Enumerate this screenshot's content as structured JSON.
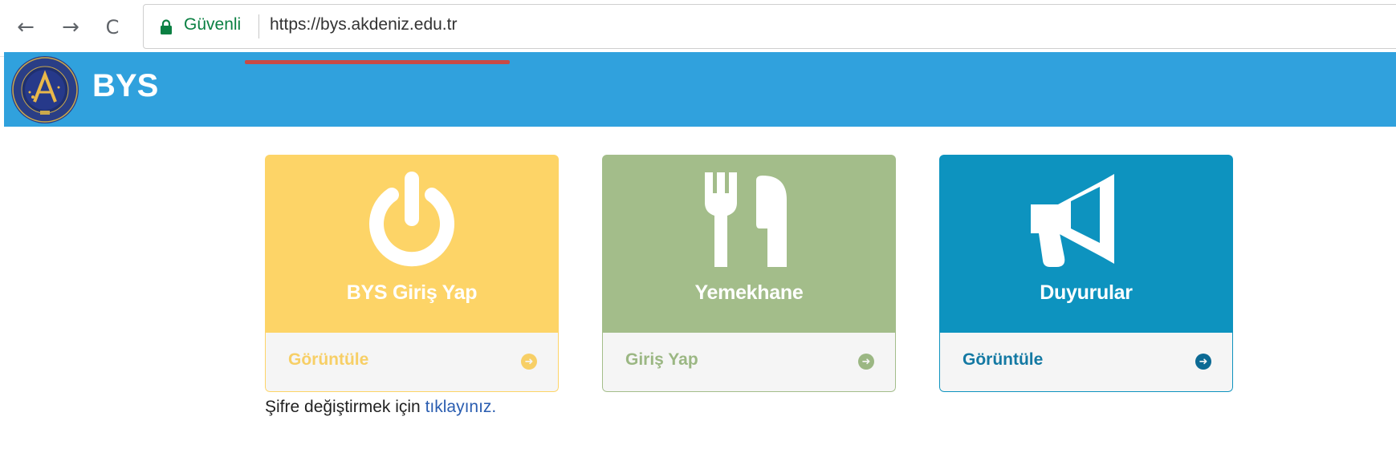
{
  "browser": {
    "back_icon": "arrow-left-icon",
    "forward_icon": "arrow-right-icon",
    "reload_icon": "reload-icon",
    "secure_label": "Güvenli",
    "url": "https://bys.akdeniz.edu.tr"
  },
  "header": {
    "title": "BYS",
    "logo": "university-seal-logo",
    "background": "#30a1dd"
  },
  "tiles": [
    {
      "title": "BYS Giriş Yap",
      "action": "Görüntüle",
      "icon": "power-icon",
      "color": "#fdd467"
    },
    {
      "title": "Yemekhane",
      "action": "Giriş Yap",
      "icon": "fork-knife-icon",
      "color": "#a3bd8a"
    },
    {
      "title": "Duyurular",
      "action": "Görüntüle",
      "icon": "megaphone-icon",
      "color": "#0d93bf"
    }
  ],
  "password_note": {
    "text": "Şifre değiştirmek için ",
    "link": "tıklayınız."
  }
}
